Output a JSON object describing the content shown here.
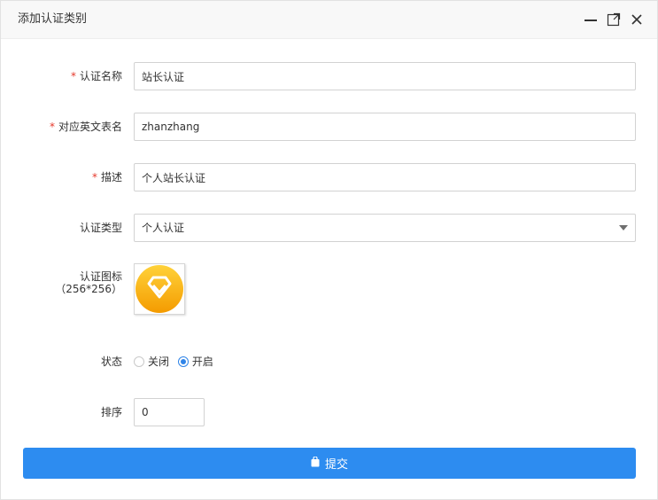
{
  "dialog": {
    "title": "添加认证类别",
    "icons": [
      "minimize-icon",
      "maximize-icon",
      "close-icon"
    ]
  },
  "form": {
    "name": {
      "label": "认证名称",
      "value": "站长认证",
      "required": true
    },
    "table": {
      "label": "对应英文表名",
      "value": "zhanzhang",
      "required": true
    },
    "desc": {
      "label": "描述",
      "value": "个人站长认证",
      "required": true
    },
    "type": {
      "label": "认证类型",
      "value": "个人认证"
    },
    "icon": {
      "label": "认证图标",
      "hint": "（256*256）",
      "icon": "diamond-icon",
      "colors": [
        "#ffd23a",
        "#f49b00"
      ]
    },
    "status": {
      "label": "状态",
      "options": [
        "关闭",
        "开启"
      ],
      "selected": "开启"
    },
    "sort": {
      "label": "排序",
      "value": "0"
    },
    "submit": {
      "label": "提交",
      "icon": "bag-icon"
    }
  },
  "colors": {
    "accent": "#2d8cf0",
    "required": "#e5382b"
  },
  "required_mark": "*"
}
